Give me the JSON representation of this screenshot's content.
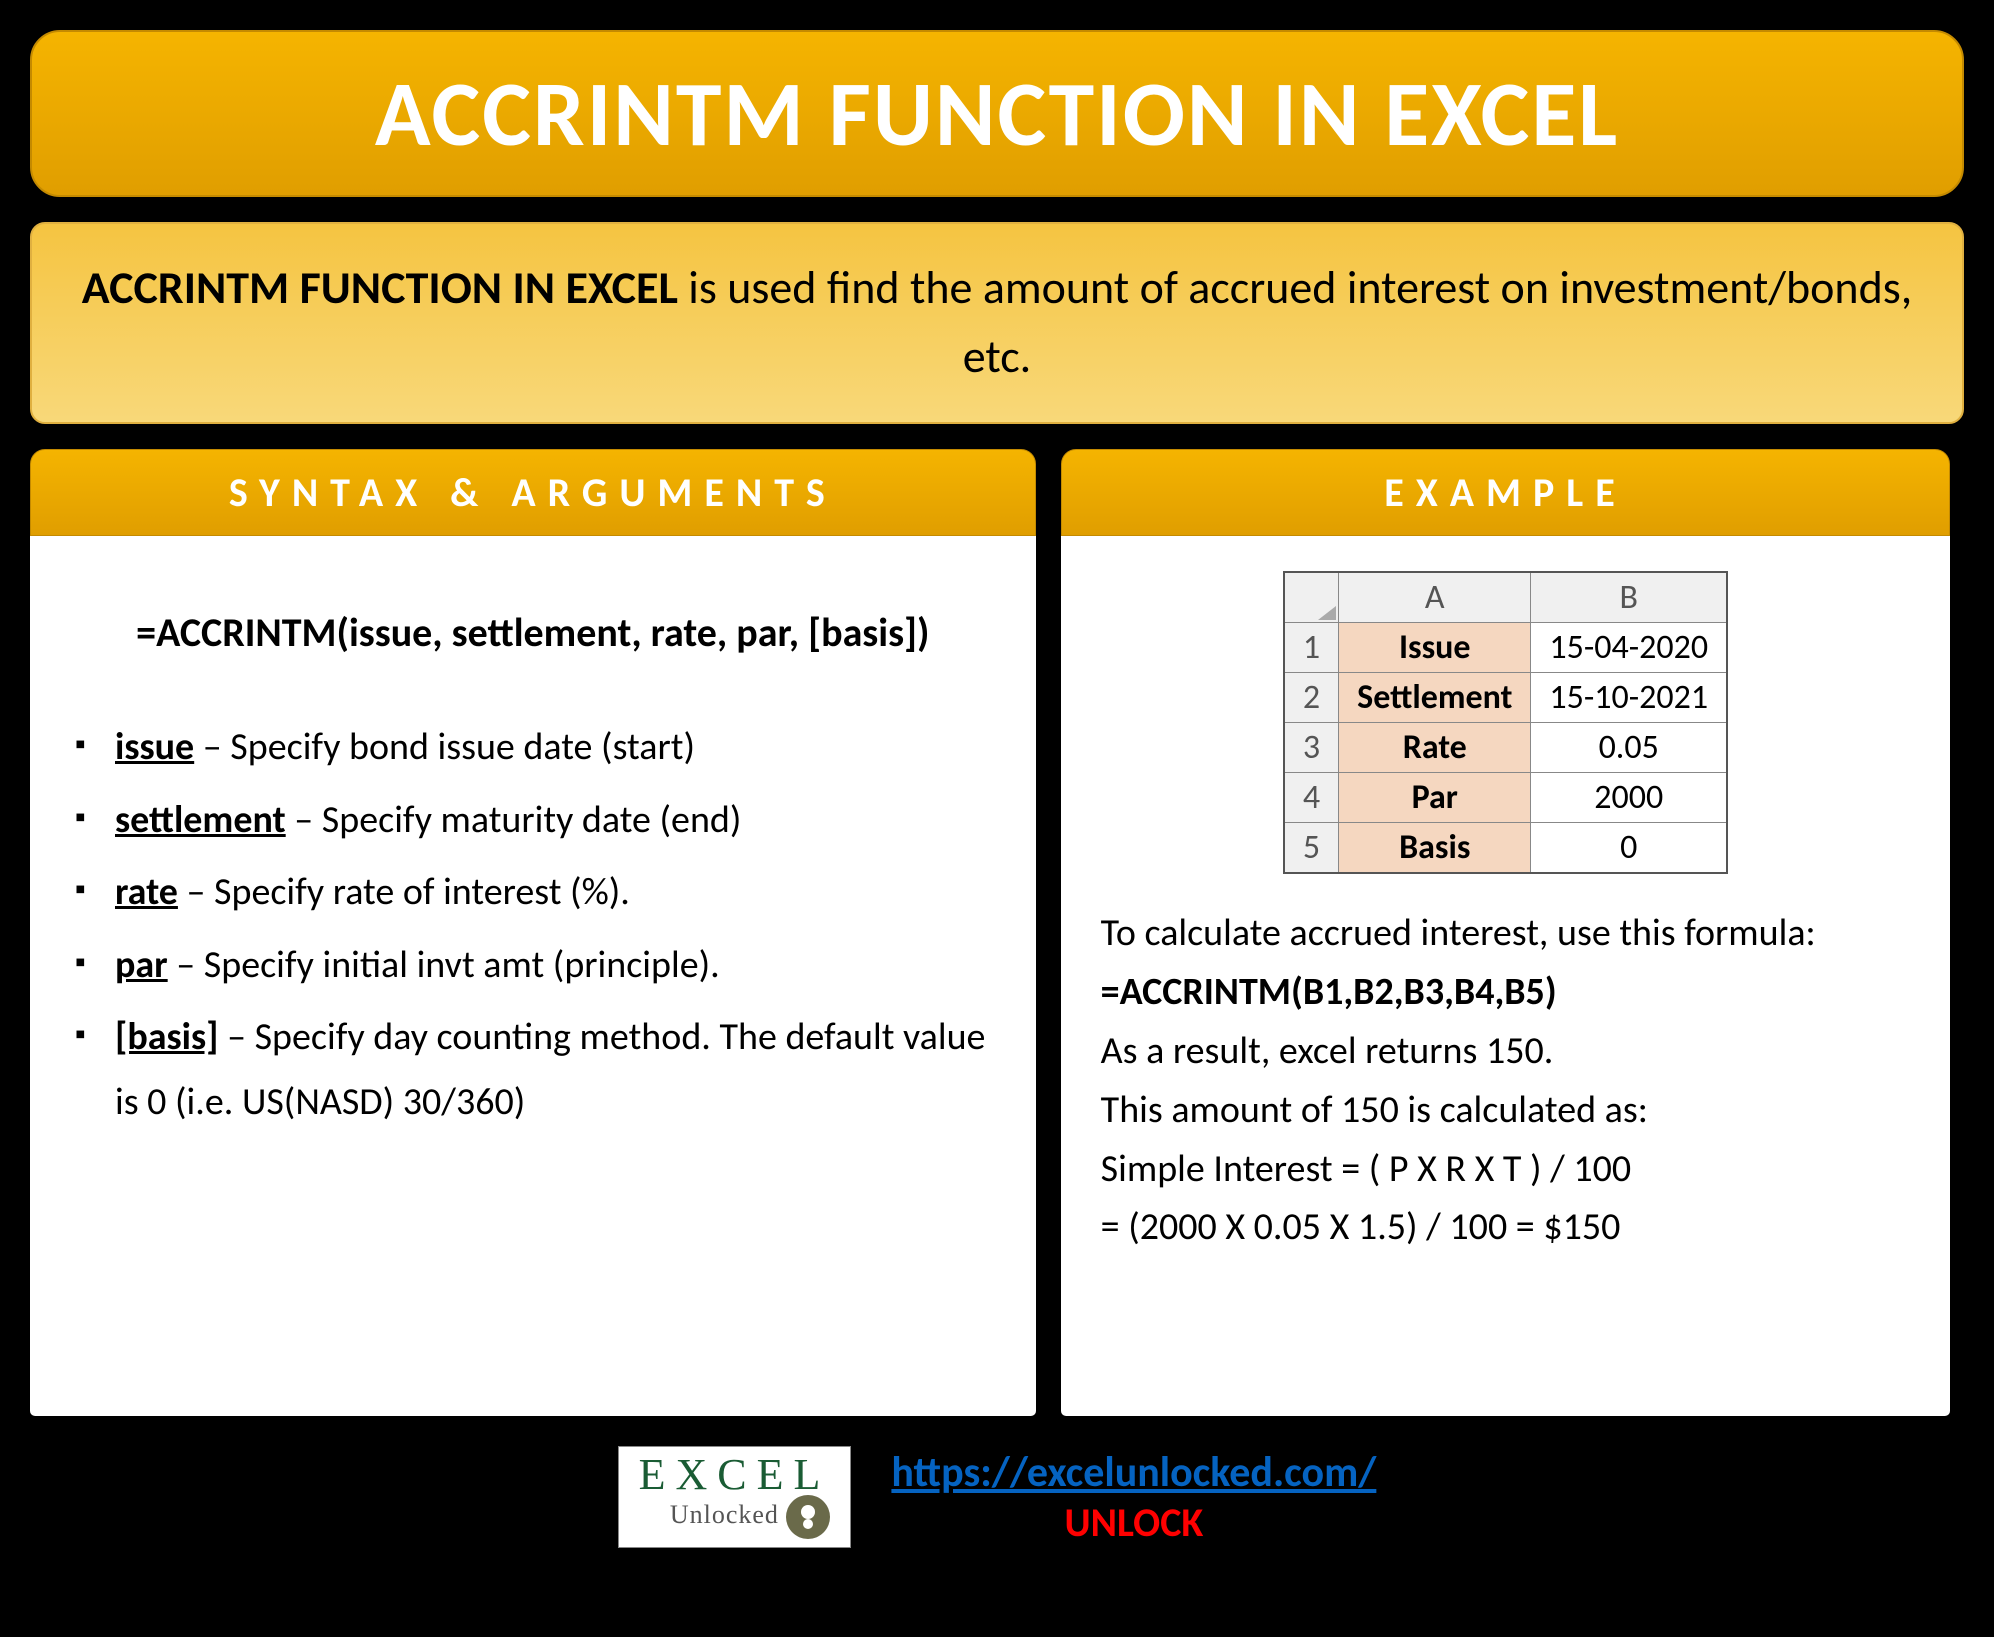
{
  "title": "ACCRINTM FUNCTION IN EXCEL",
  "description": {
    "bold_part": "ACCRINTM FUNCTION IN EXCEL",
    "rest": " is used find the amount of accrued interest on investment/bonds, etc."
  },
  "syntax": {
    "header": "SYNTAX & ARGUMENTS",
    "formula": "=ACCRINTM(issue, settlement, rate, par, [basis])",
    "args": [
      {
        "name": "issue",
        "desc": " – Specify bond issue date (start)"
      },
      {
        "name": "settlement",
        "desc": " – Specify maturity date (end)"
      },
      {
        "name": "rate",
        "desc": " – Specify rate of interest (%)."
      },
      {
        "name": "par",
        "desc": " – Specify initial invt amt (principle)."
      },
      {
        "name": "[basis]",
        "desc": " – Specify day counting method. The default value is 0 (i.e. US(NASD) 30/360)"
      }
    ]
  },
  "example": {
    "header": "EXAMPLE",
    "table": {
      "col_a": "A",
      "col_b": "B",
      "rows": [
        {
          "n": "1",
          "label": "Issue",
          "value": "15-04-2020"
        },
        {
          "n": "2",
          "label": "Settlement",
          "value": "15-10-2021"
        },
        {
          "n": "3",
          "label": "Rate",
          "value": "0.05"
        },
        {
          "n": "4",
          "label": "Par",
          "value": "2000"
        },
        {
          "n": "5",
          "label": "Basis",
          "value": "0"
        }
      ]
    },
    "intro": "To calculate accrued interest, use this formula:",
    "formula": "=ACCRINTM(B1,B2,B3,B4,B5)",
    "result_line": "As a result, excel returns 150.",
    "calc_intro": "This amount of 150 is calculated as:",
    "calc_formula": "Simple Interest = ( P X R X T ) / 100",
    "calc_sub": "= (2000 X 0.05 X 1.5) / 100 = $150"
  },
  "footer": {
    "logo_main": "EXCEL",
    "logo_sub": "Unlocked",
    "url": "https://excelunlocked.com/",
    "unlock": "UNLOCK"
  }
}
